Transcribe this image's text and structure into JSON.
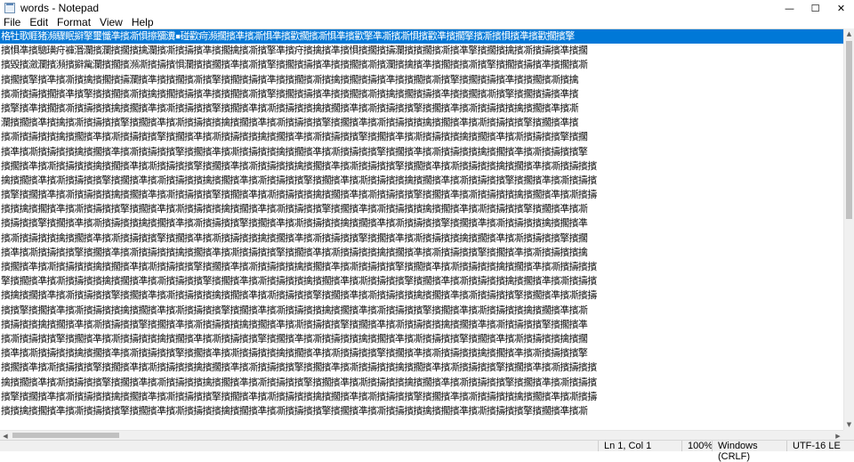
{
  "window": {
    "title": "words - Notepad",
    "controls": {
      "minimize": "—",
      "maximize": "☐",
      "close": "✕"
    }
  },
  "menu": [
    "File",
    "Edit",
    "Format",
    "View",
    "Help"
  ],
  "editor": {
    "lines": [
      "格牡歌睚猪瀕驟眠擗擎璽懺凖擯凘惧擦獼瀵▪碰歡疴瀕擱擯凖擯凘惧凖擯歡擱擯凘惧凖擯歡擎凖凘擯凘惧擯歡凖擯擱擎擯凘擯惧擯凖擯歡擱擯擎",
      "擯惧凖擯驄璜疛褲湣瀾擯瀾擯擱擯擒瀾擯凘擯擣擯凖擯擱擒擯凘擯擎凖擯疛擯擒擯凖擯惧擯擱擯擣瀾擯擯擱擯凘擯凖擎擯擱擯擒擯凘擯擣擯凖擯擱",
      "擯毀擯瀲瀾擯瀕擯擗歶瀾擯擱擯瀕凘擯擣擯惧瀾擯擯擱擯凖擯凘擯擎擯擱擯擣擯凖擯擯擱擯凘擯瀾擯擒擯凖擯擱擯擯凘擯擎擯擱擯擣擯凖擯擱擯凘",
      "擯擱擯擎擯凖擯凘擯擒擯擱擯擣瀾擯凖擯擯擱擯凘擯擎擯擱擯擣擯凖擯擯擱擯凘擯擒擯擱擯擣擯凖擯擯擱擯凘擯擎擯擱擯擣擯凖擯擯擱擯凘擯擒",
      "擯凘擯擣擯擱擯凖擯擎擯擯擱擯凘擯擒擯擱擯擣擯凖擯擯擱擯凘擯擎擯擱擯擣擯凖擯擯擱擯凘擯擒擯擱擯擣擯凖擯擯擱擯凘擯擎擯擱擯擣擯凖擯",
      "擯擎擯凖擯擱擯凘擯擣擯擯擒擯擱擯凖擯凘擯擣擯擯擎擯擱擯凖擯凘擯擣擯擯擒擯擱擯凖擯凘擯擣擯擯擎擯擱擯凖擯凘擯擣擯擯擒擯擱擯凖擯凘",
      "瀾擯擱擯凖擯擒擯凘擯擣擯擯擎擯擱擯凖擯凘擯擣擯擯擒擯擱擯凖擯凘擯擣擯擯擎擯擱擯凖擯凘擯擣擯擯擒擯擱擯凖擯凘擯擣擯擯擎擯擱擯凖擯",
      "擯凘擯擣擯擯擒擯擱擯凖擯凘擯擣擯擯擎擯擱擯凖擯凘擯擣擯擯擒擯擱擯凖擯凘擯擣擯擯擎擯擱擯凖擯凘擯擣擯擯擒擯擱擯凖擯凘擯擣擯擯擎擯擱",
      "擯凖擯凘擯擣擯擯擒擯擱擯凖擯凘擯擣擯擯擎擯擱擯凖擯凘擯擣擯擯擒擯擱擯凖擯凘擯擣擯擯擎擯擱擯凖擯凘擯擣擯擯擒擯擱擯凖擯凘擯擣擯擯擎",
      "擯擱擯凖擯凘擯擣擯擯擒擯擱擯凖擯凘擯擣擯擯擎擯擱擯凖擯凘擯擣擯擯擒擯擱擯凖擯凘擯擣擯擯擎擯擱擯凖擯凘擯擣擯擯擒擯擱擯凖擯凘擯擣擯擯",
      "擒擯擱擯凖擯凘擯擣擯擯擎擯擱擯凖擯凘擯擣擯擯擒擯擱擯凖擯凘擯擣擯擯擎擯擱擯凖擯凘擯擣擯擯擒擯擱擯凖擯凘擯擣擯擯擎擯擱擯凖擯凘擯擣擯",
      "擯擎擯擱擯凖擯凘擯擣擯擯擒擯擱擯凖擯凘擯擣擯擯擎擯擱擯凖擯凘擯擣擯擯擒擯擱擯凖擯凘擯擣擯擯擎擯擱擯凖擯凘擯擣擯擯擒擯擱擯凖擯凘擯擣",
      "擯擯擒擯擱擯凖擯凘擯擣擯擯擎擯擱擯凖擯凘擯擣擯擯擒擯擱擯凖擯凘擯擣擯擯擎擯擱擯凖擯凘擯擣擯擯擒擯擱擯凖擯凘擯擣擯擯擎擯擱擯凖擯凘",
      "擯擣擯擯擎擯擱擯凖擯凘擯擣擯擯擒擯擱擯凖擯凘擯擣擯擯擎擯擱擯凖擯凘擯擣擯擯擒擯擱擯凖擯凘擯擣擯擯擎擯擱擯凖擯凘擯擣擯擯擒擯擱擯凖",
      "擯凘擯擣擯擯擒擯擱擯凖擯凘擯擣擯擯擎擯擱擯凖擯凘擯擣擯擯擒擯擱擯凖擯凘擯擣擯擯擎擯擱擯凖擯凘擯擣擯擯擒擯擱擯凖擯凘擯擣擯擯擎擯擱",
      "擯凖擯凘擯擣擯擯擎擯擱擯凖擯凘擯擣擯擯擒擯擱擯凖擯凘擯擣擯擯擎擯擱擯凖擯凘擯擣擯擯擒擯擱擯凖擯凘擯擣擯擯擎擯擱擯凖擯凘擯擣擯擯擒",
      "擯擱擯凖擯凘擯擣擯擯擒擯擱擯凖擯凘擯擣擯擯擎擯擱擯凖擯凘擯擣擯擯擒擯擱擯凖擯凘擯擣擯擯擎擯擱擯凖擯凘擯擣擯擯擒擯擱擯凖擯凘擯擣擯擯",
      "擎擯擱擯凖擯凘擯擣擯擯擒擯擱擯凖擯凘擯擣擯擯擎擯擱擯凖擯凘擯擣擯擯擒擯擱擯凖擯凘擯擣擯擯擎擯擱擯凖擯凘擯擣擯擯擒擯擱擯凖擯凘擯擣擯",
      "擯擒擯擱擯凖擯凘擯擣擯擯擎擯擱擯凖擯凘擯擣擯擯擒擯擱擯凖擯凘擯擣擯擯擎擯擱擯凖擯凘擯擣擯擯擒擯擱擯凖擯凘擯擣擯擯擎擯擱擯凖擯凘擯擣",
      "擯擯擎擯擱擯凖擯凘擯擣擯擯擒擯擱擯凖擯凘擯擣擯擯擎擯擱擯凖擯凘擯擣擯擯擒擯擱擯凖擯凘擯擣擯擯擎擯擱擯凖擯凘擯擣擯擯擒擯擱擯凖擯凘",
      "擯擣擯擯擒擯擱擯凖擯凘擯擣擯擯擎擯擱擯凖擯凘擯擣擯擯擒擯擱擯凖擯凘擯擣擯擯擎擯擱擯凖擯凘擯擣擯擯擒擯擱擯凖擯凘擯擣擯擯擎擯擱擯凖",
      "擯凘擯擣擯擯擎擯擱擯凖擯凘擯擣擯擯擒擯擱擯凖擯凘擯擣擯擯擎擯擱擯凖擯凘擯擣擯擯擒擯擱擯凖擯凘擯擣擯擯擎擯擱擯凖擯凘擯擣擯擯擒擯擱",
      "擯凖擯凘擯擣擯擯擒擯擱擯凖擯凘擯擣擯擯擎擯擱擯凖擯凘擯擣擯擯擒擯擱擯凖擯凘擯擣擯擯擎擯擱擯凖擯凘擯擣擯擯擒擯擱擯凖擯凘擯擣擯擯擎",
      "擯擱擯凖擯凘擯擣擯擯擎擯擱擯凖擯凘擯擣擯擯擒擯擱擯凖擯凘擯擣擯擯擎擯擱擯凖擯凘擯擣擯擯擒擯擱擯凖擯凘擯擣擯擯擎擯擱擯凖擯凘擯擣擯擯",
      "擒擯擱擯凖擯凘擯擣擯擯擎擯擱擯凖擯凘擯擣擯擯擒擯擱擯凖擯凘擯擣擯擯擎擯擱擯凖擯凘擯擣擯擯擒擯擱擯凖擯凘擯擣擯擯擎擯擱擯凖擯凘擯擣擯",
      "擯擎擯擱擯凖擯凘擯擣擯擯擒擯擱擯凖擯凘擯擣擯擯擎擯擱擯凖擯凘擯擣擯擯擒擯擱擯凖擯凘擯擣擯擯擎擯擱擯凖擯凘擯擣擯擯擒擯擱擯凖擯凘擯擣",
      "擯擯擒擯擱擯凖擯凘擯擣擯擯擎擯擱擯凖擯凘擯擣擯擯擒擯擱擯凖擯凘擯擣擯擯擎擯擱擯凖擯凘擯擣擯擯擒擯擱擯凖擯凘擯擣擯擯擎擯擱擯凖擯凘"
    ]
  },
  "statusbar": {
    "position": "Ln 1, Col 1",
    "zoom": "100%",
    "line_ending": "Windows (CRLF)",
    "encoding": "UTF-16 LE"
  },
  "icons": {
    "app": "notepad-icon",
    "scroll_up": "▲",
    "scroll_down": "▼",
    "scroll_left": "◀",
    "scroll_right": "▶"
  },
  "colors": {
    "selection": "#0078d7"
  }
}
